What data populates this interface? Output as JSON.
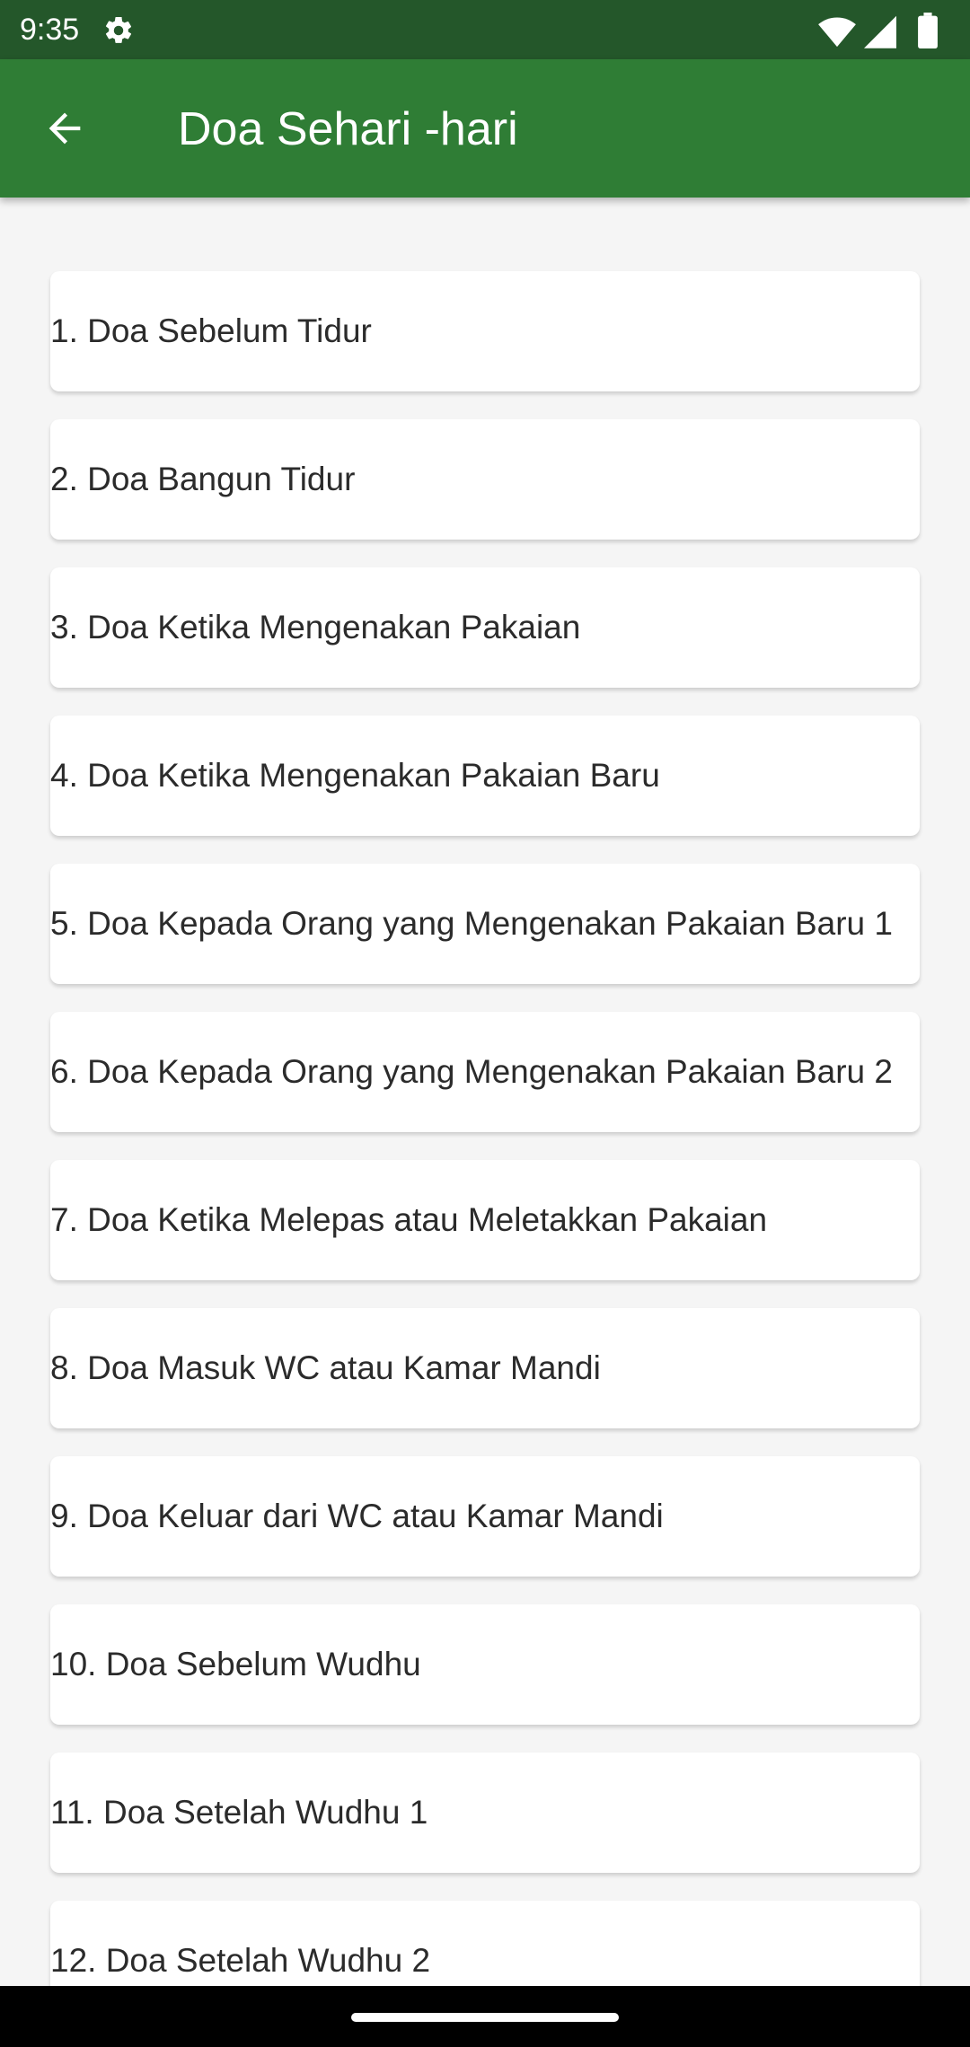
{
  "status_bar": {
    "time": "9:35",
    "icons": [
      "gear-icon",
      "wifi-icon",
      "signal-icon",
      "battery-icon"
    ]
  },
  "app_bar": {
    "title": "Doa Sehari -hari",
    "back_icon": "arrow-back-icon",
    "color": "#2f7d35"
  },
  "items": [
    "1.  Doa Sebelum Tidur",
    "2.  Doa Bangun Tidur",
    "3.  Doa Ketika Mengenakan Pakaian",
    "4.  Doa Ketika Mengenakan Pakaian Baru",
    "5.  Doa Kepada Orang yang Mengenakan Pakaian Baru 1",
    "6.  Doa Kepada Orang yang Mengenakan Pakaian Baru 2",
    "7.  Doa Ketika Melepas atau Meletakkan Pakaian",
    "8.  Doa Masuk WC atau Kamar Mandi",
    "9.  Doa Keluar dari WC atau Kamar Mandi",
    "10.  Doa Sebelum Wudhu",
    "11.  Doa Setelah Wudhu 1",
    "12.  Doa Setelah Wudhu 2"
  ]
}
